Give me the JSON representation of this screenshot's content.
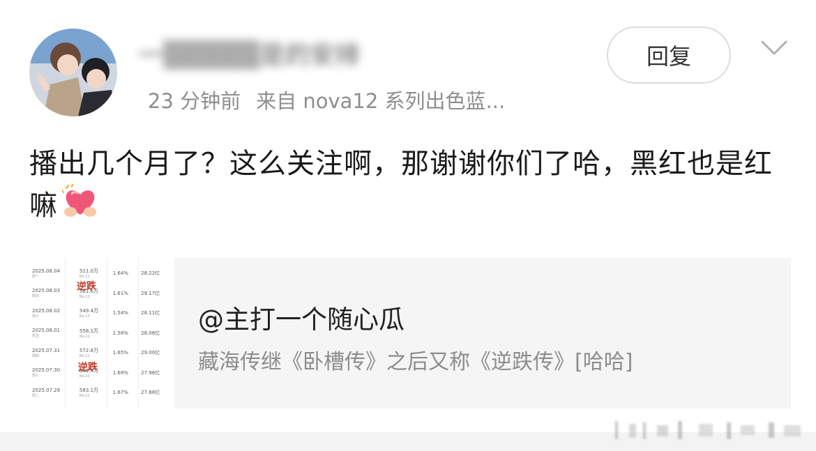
{
  "post": {
    "username": "一▒▒▒▒▒是的安排",
    "time": "23 分钟前",
    "source": "来自 nova12 系列出色蓝...",
    "reply_label": "回复",
    "text": "播出几个月了？这么关注啊，那谢谢你们了哈，黑红也是红嘛"
  },
  "card": {
    "title": "@主打一个随心瓜",
    "description": "藏海传继《卧槽传》之后又称《逆跌传》[哈哈]",
    "thumbnail": {
      "stamp_text": "逆跌",
      "rows": [
        {
          "date": "2025.08.04",
          "day": "周一",
          "value": "511.0万",
          "rank": "No.11",
          "share": "1.64%",
          "total": "28.22亿"
        },
        {
          "date": "2025.08.03",
          "day": "周日",
          "value": "561.6万",
          "rank": "No.12",
          "share": "1.61%",
          "total": "29.17亿"
        },
        {
          "date": "2025.08.02",
          "day": "周六",
          "value": "549.4万",
          "rank": "No.13",
          "share": "1.54%",
          "total": "28.11亿"
        },
        {
          "date": "2025.08.01",
          "day": "周五",
          "value": "558.1万",
          "rank": "No.12",
          "share": "1.58%",
          "total": "28.06亿"
        },
        {
          "date": "2025.07.31",
          "day": "周四",
          "value": "572.8万",
          "rank": "No.11",
          "share": "1.65%",
          "total": "29.00亿"
        },
        {
          "date": "2025.07.30",
          "day": "周三",
          "value": "602.4万",
          "rank": "No.10",
          "share": "1.69%",
          "total": "27.96亿"
        },
        {
          "date": "2025.07.29",
          "day": "周二",
          "value": "583.1万",
          "rank": "No.11",
          "share": "1.67%",
          "total": "27.88亿"
        }
      ]
    }
  },
  "icons": {
    "more": "chevron-down-icon",
    "emoji": "heart-hands-emoji-icon"
  },
  "colors": {
    "meta_text": "#8e8e8e",
    "card_bg": "#f5f5f5",
    "stamp": "#c0392b"
  }
}
